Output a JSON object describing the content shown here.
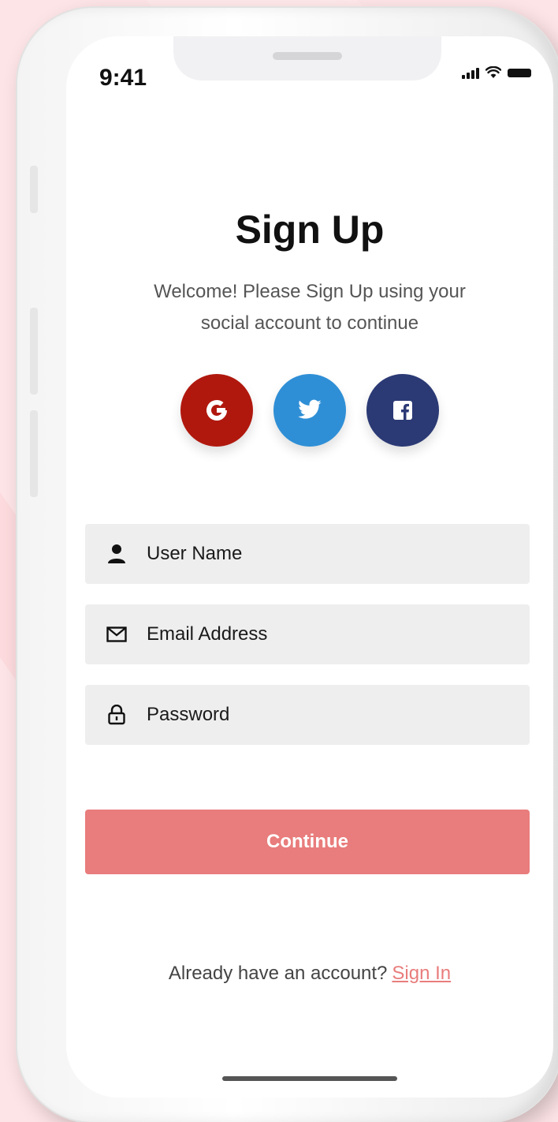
{
  "status_bar": {
    "time": "9:41"
  },
  "header": {
    "title": "Sign Up",
    "subtitle_line1": "Welcome! Please Sign Up using your",
    "subtitle_line2": "social account to continue"
  },
  "social_buttons": [
    {
      "name": "google",
      "icon": "google-icon",
      "color": "#b0180e"
    },
    {
      "name": "twitter",
      "icon": "twitter-icon",
      "color": "#2f8fd6"
    },
    {
      "name": "facebook",
      "icon": "facebook-icon",
      "color": "#2b3a75"
    }
  ],
  "form": {
    "username_placeholder": "User Name",
    "email_placeholder": "Email Address",
    "password_placeholder": "Password",
    "continue_label": "Continue"
  },
  "footer": {
    "prompt": "Already have an account?",
    "signin_label": "Sign In"
  },
  "colors": {
    "accent": "#e97c7c",
    "background": "#fde4e6",
    "field_bg": "#eeeeee"
  }
}
